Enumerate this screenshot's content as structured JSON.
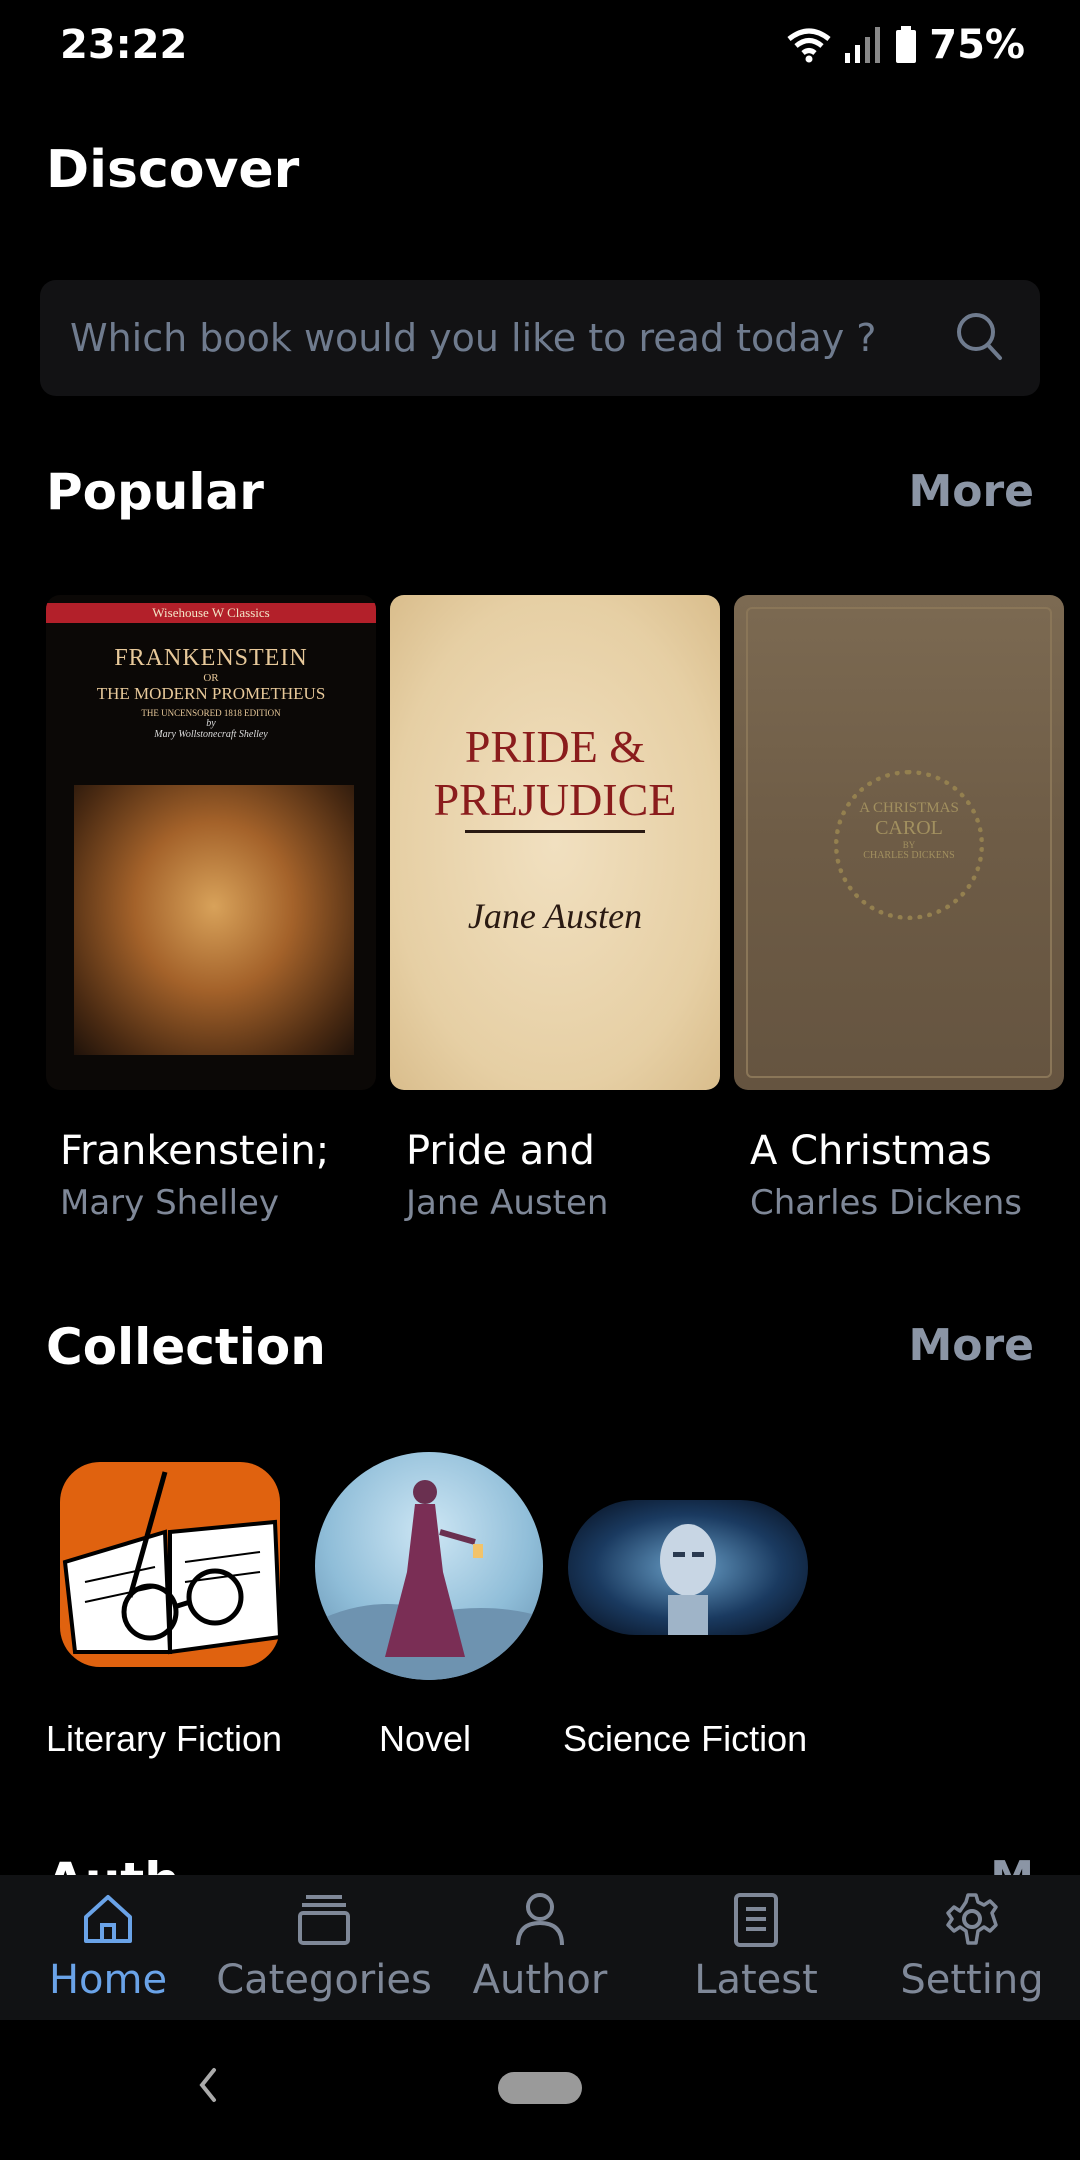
{
  "status": {
    "time": "23:22",
    "battery": "75%"
  },
  "header": {
    "title": "Discover"
  },
  "search": {
    "placeholder": "Which book would you like to read today ?"
  },
  "popular": {
    "title": "Popular",
    "more": "More",
    "books": [
      {
        "title": "Frankenstein;",
        "author": "Mary Shelley",
        "cover_lines": [
          "FRANKENSTEIN",
          "OR",
          "THE MODERN PROMETHEUS",
          "THE UNCENSORED 1818 EDITION",
          "by",
          "Mary Wollstonecraft Shelley"
        ],
        "publisher": "Wisehouse W Classics"
      },
      {
        "title": "Pride and",
        "author": "Jane Austen",
        "cover_lines": [
          "PRIDE &",
          "PREJUDICE",
          "Jane Austen"
        ]
      },
      {
        "title": "A Christmas",
        "author": "Charles Dickens",
        "cover_lines": [
          "A CHRISTMAS",
          "CAROL",
          "BY",
          "CHARLES DICKENS"
        ]
      }
    ]
  },
  "collection": {
    "title": "Collection",
    "more": "More",
    "items": [
      {
        "label": "Literary Fiction"
      },
      {
        "label": "Novel"
      },
      {
        "label": "Science Fiction"
      }
    ]
  },
  "next_section": {
    "title": "Auth",
    "more": "M"
  },
  "nav": {
    "items": [
      {
        "label": "Home",
        "icon": "home-icon",
        "active": true
      },
      {
        "label": "Categories",
        "icon": "layers-icon"
      },
      {
        "label": "Author",
        "icon": "person-icon"
      },
      {
        "label": "Latest",
        "icon": "clipboard-icon"
      },
      {
        "label": "Setting",
        "icon": "gear-icon"
      }
    ]
  },
  "colors": {
    "accent": "#6aa3e8",
    "muted": "#7f8898",
    "background": "#000000"
  }
}
